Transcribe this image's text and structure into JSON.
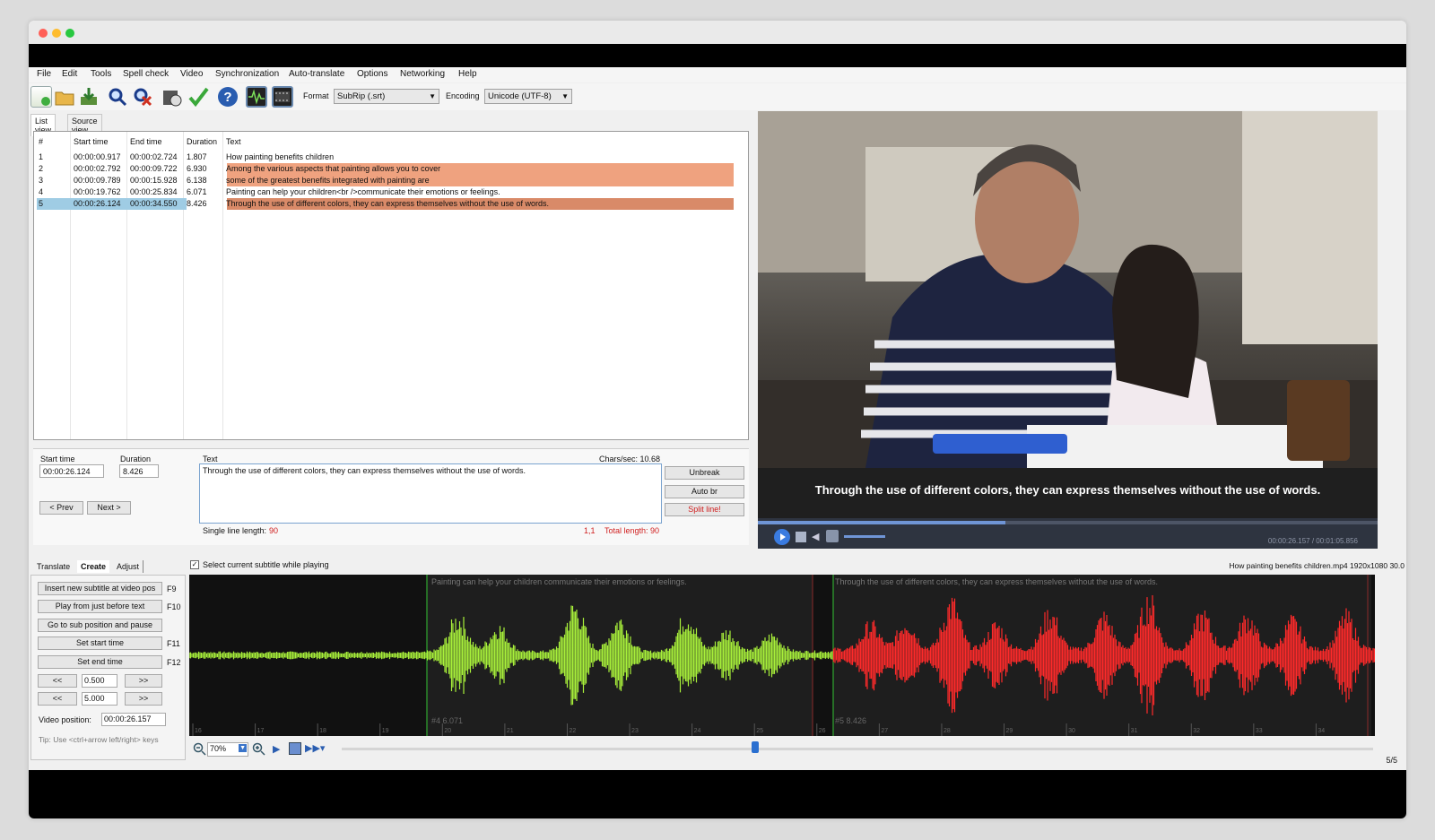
{
  "menu": [
    "File",
    "Edit",
    "Tools",
    "Spell check",
    "Video",
    "Synchronization",
    "Auto-translate",
    "Options",
    "Networking",
    "Help"
  ],
  "toolbar": {
    "format_label": "Format",
    "format_value": "SubRip (.srt)",
    "encoding_label": "Encoding",
    "encoding_value": "Unicode (UTF-8)",
    "icons": [
      "new-icon",
      "open-icon",
      "save-icon",
      "find-icon",
      "replace-icon",
      "visual-sync-icon",
      "spell-check-icon",
      "help-icon",
      "waveform-icon",
      "video-icon"
    ]
  },
  "view_tabs": [
    "List view",
    "Source view"
  ],
  "grid": {
    "headers": [
      "#",
      "Start time",
      "End time",
      "Duration",
      "Text"
    ],
    "rows": [
      {
        "num": "1",
        "start": "00:00:00.917",
        "end": "00:00:02.724",
        "duration": "1.807",
        "text": "How painting benefits children",
        "highlight": false,
        "selected": false
      },
      {
        "num": "2",
        "start": "00:00:02.792",
        "end": "00:00:09.722",
        "duration": "6.930",
        "text": "Among the various aspects that painting allows you to cover",
        "highlight": true,
        "selected": false
      },
      {
        "num": "3",
        "start": "00:00:09.789",
        "end": "00:00:15.928",
        "duration": "6.138",
        "text": "some of the greatest benefits integrated with painting are",
        "highlight": true,
        "selected": false
      },
      {
        "num": "4",
        "start": "00:00:19.762",
        "end": "00:00:25.834",
        "duration": "6.071",
        "text": "Painting can help your children<br />communicate their emotions or feelings.",
        "highlight": false,
        "selected": false
      },
      {
        "num": "5",
        "start": "00:00:26.124",
        "end": "00:00:34.550",
        "duration": "8.426",
        "text": "Through the use of different colors, they can express themselves without the use of words.",
        "highlight": true,
        "selected": true
      }
    ]
  },
  "editor": {
    "start_time_label": "Start time",
    "start_time_value": "00:00:26.124",
    "duration_label": "Duration",
    "duration_value": "8.426",
    "text_label": "Text",
    "chars_sec": "Chars/sec: 10.68",
    "text_value": "Through the use of different colors, they can express themselves without the use of words.",
    "unbreak": "Unbreak",
    "auto_br": "Auto br",
    "split_line": "Split line!",
    "prev": "< Prev",
    "next": "Next >",
    "single_line_label": "Single line length:",
    "single_line_value": "90",
    "cursor_pos": "1,1",
    "total_length": "Total length: 90"
  },
  "video": {
    "subtitle": "Through the use of different colors, they can express themselves without the use of words.",
    "time": "00:00:26.157 / 00:01:05.856",
    "progress": 0.4
  },
  "bottom_tabs": [
    "Translate",
    "Create",
    "Adjust"
  ],
  "select_current_label": "Select current subtitle while playing",
  "file_info": "How painting benefits children.mp4 1920x1080  30.0",
  "create": {
    "insert": "Insert new subtitle at video pos",
    "insert_key": "F9",
    "play_before": "Play from just before text",
    "play_key": "F10",
    "goto_sub": "Go to sub position and pause",
    "set_start": "Set start time",
    "set_start_key": "F11",
    "set_end": "Set end time",
    "set_end_key": "F12",
    "back": "<<",
    "forward": ">>",
    "step1": "0.500",
    "step2": "5.000",
    "video_pos_label": "Video position:",
    "video_pos_value": "00:00:26.157",
    "tip": "Tip: Use <ctrl+arrow left/right> keys"
  },
  "waveform": {
    "seg4_text": "Painting can help your children  communicate their emotions or feelings.",
    "seg4_label": "#4  6.071",
    "seg5_text": "Through the use of different colors, they can express themselves without the use of words.",
    "seg5_label": "#5  8.426",
    "ticks": [
      "16",
      "17",
      "18",
      "19",
      "20",
      "21",
      "22",
      "23",
      "24",
      "25",
      "26",
      "27",
      "28",
      "29",
      "30",
      "31",
      "32",
      "33",
      "34"
    ],
    "zoom": "70%",
    "green": "#a8f03a",
    "red": "#ff2a2a"
  },
  "status_right": "5/5"
}
